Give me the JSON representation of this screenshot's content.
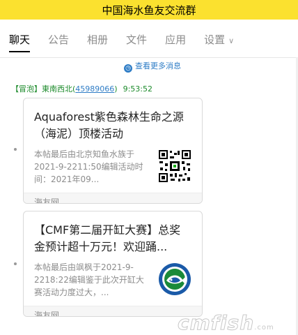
{
  "header": {
    "title": "中国海水鱼友交流群"
  },
  "tabs": [
    {
      "label": "聊天"
    },
    {
      "label": "公告"
    },
    {
      "label": "相册"
    },
    {
      "label": "文件"
    },
    {
      "label": "应用"
    },
    {
      "label": "设置"
    }
  ],
  "more_messages": "查看更多消息",
  "message": {
    "sender": "【冒泡】東南西北(",
    "uid": "45989066",
    "sender_end": ")",
    "time": "9:53:52"
  },
  "cards": [
    {
      "title": "Aquaforest紫色森林生命之源（海泥）顶楼活动",
      "desc": "本帖最后由北京知鱼水族于2021-9-2211:50编辑活动时间：2021年09...",
      "source": "海友网",
      "thumb_icon": "qr-code-icon"
    },
    {
      "title": "【CMF第二届开缸大赛】总奖金预计超十万元！欢迎踊...",
      "desc": "本帖最后由飒枫于2021-9-2218:22编辑鉴于此次开缸大赛活动力度过大，...",
      "source": "海友网",
      "thumb_icon": "fish-logo-icon"
    }
  ],
  "watermark": {
    "text": "cmfish",
    "suffix": ".com"
  },
  "colors": {
    "header_bg": "#fbe12f",
    "link": "#2f7dc6",
    "sender": "#1b8a2a"
  }
}
